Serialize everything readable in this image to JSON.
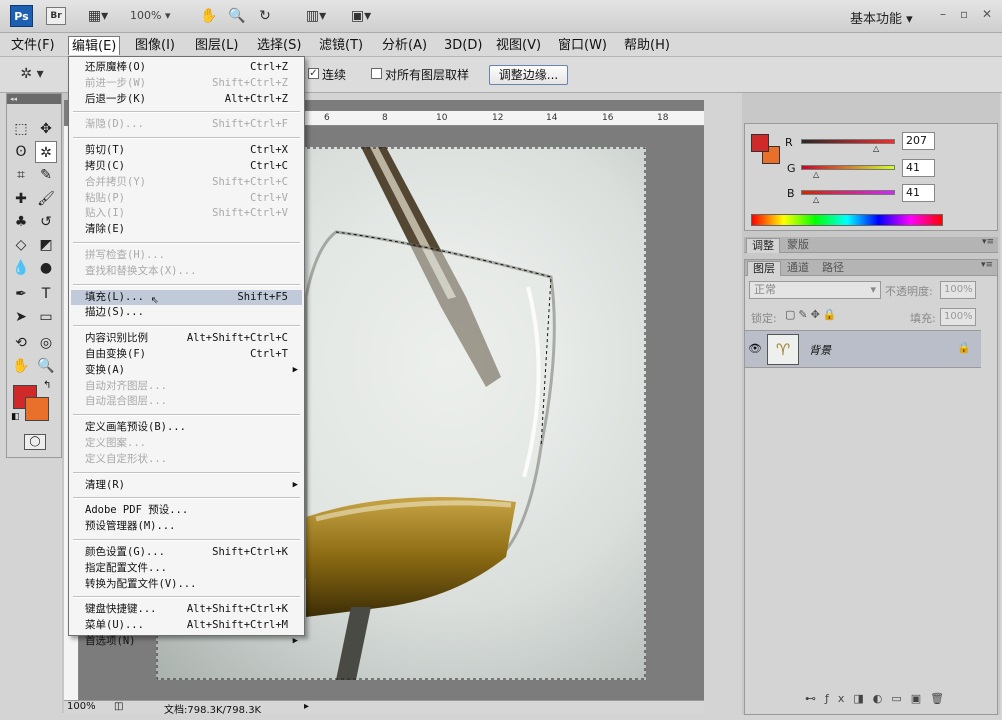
{
  "app": {
    "logo": "Ps",
    "bridge": "Br",
    "zoom": "100%",
    "workspace": "基本功能"
  },
  "menubar": [
    "文件(F)",
    "编辑(E)",
    "图像(I)",
    "图层(L)",
    "选择(S)",
    "滤镜(T)",
    "分析(A)",
    "3D(D)",
    "视图(V)",
    "窗口(W)",
    "帮助(H)"
  ],
  "options": {
    "contiguous": "连续",
    "sample_all": "对所有图层取样",
    "refine_edge": "调整边缘..."
  },
  "ruler": [
    "6",
    "8",
    "10",
    "12",
    "14",
    "16",
    "18"
  ],
  "edit_menu": [
    {
      "label": "还原魔棒(O)",
      "shortcut": "Ctrl+Z",
      "disabled": false
    },
    {
      "label": "前进一步(W)",
      "shortcut": "Shift+Ctrl+Z",
      "disabled": true
    },
    {
      "label": "后退一步(K)",
      "shortcut": "Alt+Ctrl+Z",
      "disabled": false
    },
    {
      "sep": true
    },
    {
      "label": "渐隐(D)...",
      "shortcut": "Shift+Ctrl+F",
      "disabled": true
    },
    {
      "sep": true
    },
    {
      "label": "剪切(T)",
      "shortcut": "Ctrl+X",
      "disabled": false
    },
    {
      "label": "拷贝(C)",
      "shortcut": "Ctrl+C",
      "disabled": false
    },
    {
      "label": "合并拷贝(Y)",
      "shortcut": "Shift+Ctrl+C",
      "disabled": true
    },
    {
      "label": "粘贴(P)",
      "shortcut": "Ctrl+V",
      "disabled": true
    },
    {
      "label": "贴入(I)",
      "shortcut": "Shift+Ctrl+V",
      "disabled": true
    },
    {
      "label": "清除(E)",
      "shortcut": "",
      "disabled": false
    },
    {
      "sep": true
    },
    {
      "label": "拼写检查(H)...",
      "shortcut": "",
      "disabled": true
    },
    {
      "label": "查找和替换文本(X)...",
      "shortcut": "",
      "disabled": true
    },
    {
      "sep": true
    },
    {
      "label": "填充(L)...",
      "shortcut": "Shift+F5",
      "disabled": false,
      "highlight": true
    },
    {
      "label": "描边(S)...",
      "shortcut": "",
      "disabled": false
    },
    {
      "sep": true
    },
    {
      "label": "内容识别比例",
      "shortcut": "Alt+Shift+Ctrl+C",
      "disabled": false
    },
    {
      "label": "自由变换(F)",
      "shortcut": "Ctrl+T",
      "disabled": false
    },
    {
      "label": "变换(A)",
      "shortcut": "",
      "disabled": false,
      "submenu": true
    },
    {
      "label": "自动对齐图层...",
      "shortcut": "",
      "disabled": true
    },
    {
      "label": "自动混合图层...",
      "shortcut": "",
      "disabled": true
    },
    {
      "sep": true
    },
    {
      "label": "定义画笔预设(B)...",
      "shortcut": "",
      "disabled": false
    },
    {
      "label": "定义图案...",
      "shortcut": "",
      "disabled": true
    },
    {
      "label": "定义自定形状...",
      "shortcut": "",
      "disabled": true
    },
    {
      "sep": true
    },
    {
      "label": "清理(R)",
      "shortcut": "",
      "disabled": false,
      "submenu": true
    },
    {
      "sep": true
    },
    {
      "label": "Adobe PDF 预设...",
      "shortcut": "",
      "disabled": false
    },
    {
      "label": "预设管理器(M)...",
      "shortcut": "",
      "disabled": false
    },
    {
      "sep": true
    },
    {
      "label": "颜色设置(G)...",
      "shortcut": "Shift+Ctrl+K",
      "disabled": false
    },
    {
      "label": "指定配置文件...",
      "shortcut": "",
      "disabled": false
    },
    {
      "label": "转换为配置文件(V)...",
      "shortcut": "",
      "disabled": false
    },
    {
      "sep": true
    },
    {
      "label": "键盘快捷键...",
      "shortcut": "Alt+Shift+Ctrl+K",
      "disabled": false
    },
    {
      "label": "菜单(U)...",
      "shortcut": "Alt+Shift+Ctrl+M",
      "disabled": false
    },
    {
      "label": "首选项(N)",
      "shortcut": "",
      "disabled": false,
      "submenu": true
    }
  ],
  "color_panel": {
    "r_label": "R",
    "g_label": "G",
    "b_label": "B",
    "r": "207",
    "g": "41",
    "b": "41",
    "fg": "#cf2929",
    "bg": "#e8702a"
  },
  "adjust_tabs": [
    "调整",
    "蒙版"
  ],
  "layers": {
    "tabs": [
      "图层",
      "通道",
      "路径"
    ],
    "blend": "正常",
    "opacity_label": "不透明度:",
    "opacity": "100%",
    "lock_label": "锁定:",
    "fill_label": "填充:",
    "fill": "100%",
    "layer_name": "背景"
  },
  "status": {
    "zoom": "100%",
    "doc": "文档:798.3K/798.3K"
  }
}
